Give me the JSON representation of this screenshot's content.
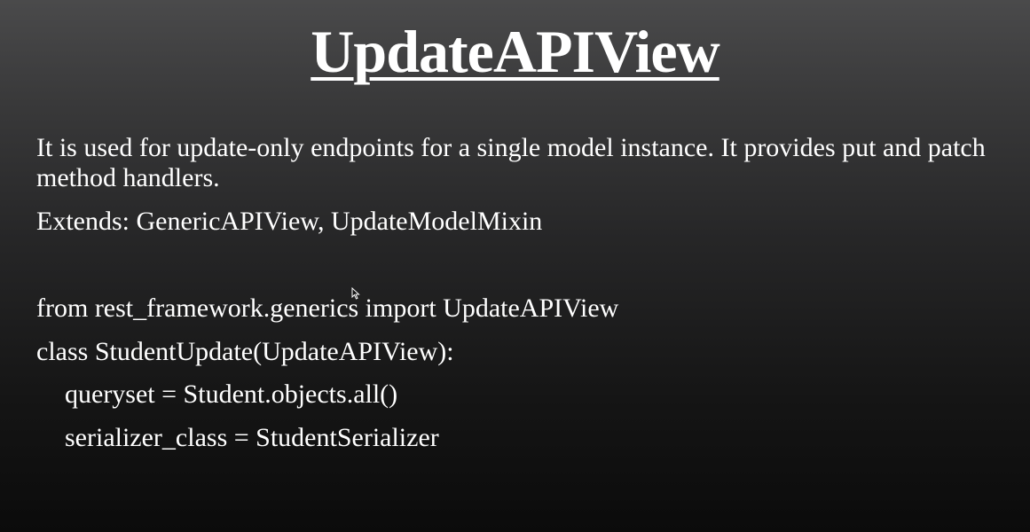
{
  "slide": {
    "title": "UpdateAPIView",
    "description": "It is used for update-only endpoints for a single model instance. It provides put and patch method handlers.",
    "extends": "Extends: GenericAPIView, UpdateModelMixin",
    "code": {
      "line1": "from rest_framework.generics import UpdateAPIView",
      "line2": "class StudentUpdate(UpdateAPIView):",
      "line3": "queryset = Student.objects.all()",
      "line4": "serializer_class = StudentSerializer"
    }
  },
  "icons": {
    "cursor": "mouse-pointer-icon"
  }
}
